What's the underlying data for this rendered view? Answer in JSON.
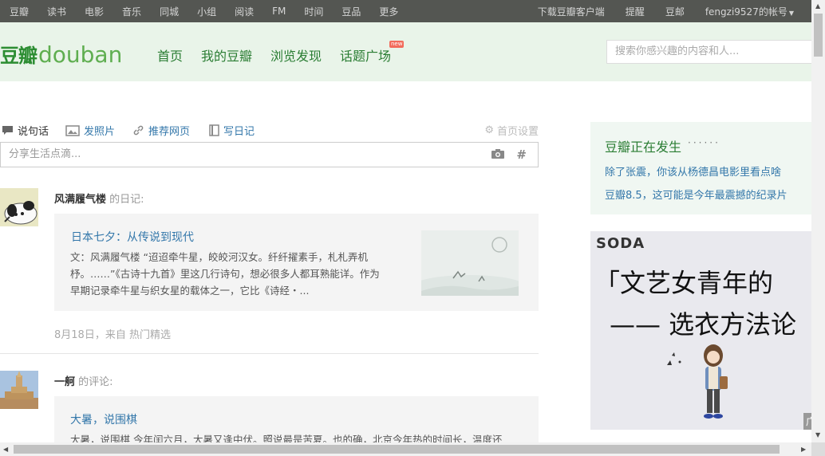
{
  "topnav": {
    "items": [
      "豆瓣",
      "读书",
      "电影",
      "音乐",
      "同城",
      "小组",
      "阅读",
      "FM",
      "时间",
      "豆品",
      "更多"
    ],
    "right": {
      "download": "下载豆瓣客户端",
      "remind": "提醒",
      "coin": "豆邮",
      "account": "fengzi9527的帐号"
    }
  },
  "logo": {
    "cn": "豆瓣",
    "en": "douban"
  },
  "mainnav": {
    "items": [
      "首页",
      "我的豆瓣",
      "浏览发现",
      "话题广场"
    ],
    "badge": "new"
  },
  "search": {
    "placeholder": "搜索你感兴趣的内容和人..."
  },
  "composer": {
    "tabs": [
      "说句话",
      "发照片",
      "推荐网页",
      "写日记"
    ],
    "settings": "首页设置",
    "placeholder": "分享生活点滴...",
    "hash": "#"
  },
  "feed": [
    {
      "user": "风满履气楼",
      "action": "的日记:",
      "title": "日本七夕：从传说到现代",
      "body_lines": [
        "文：风满履气楼 “迢迢牵牛星，皎皎河汉女。纤纤擢素手，札札弄机",
        "杼。……”《古诗十九首》里这几行诗句，想必很多人都耳熟能详。作为",
        "早期记录牵牛星与织女星的载体之一，它比《诗经・..."
      ],
      "meta": "8月18日，来自 热门精选"
    },
    {
      "user": "一舸",
      "action": "的评论:",
      "title": "大暑，说围棋",
      "body_lines": [
        "大暑，说围棋 今年闰六月，大暑又逢中伏。照说最是苦夏。也的确，北京今年热的时间长，温度还"
      ]
    }
  ],
  "happening": {
    "title": "豆瓣正在发生",
    "dots": "······",
    "links": [
      "除了张震，你该从杨德昌电影里看点啥",
      "豆瓣8.5，这可能是今年最震撼的纪录片"
    ]
  },
  "ad": {
    "brand": "SODA",
    "line1": "「文艺女青年的",
    "line2": "—— 选衣方法论",
    "corner": "广"
  },
  "colors": {
    "topbar": "#545652",
    "header": "#e9f4e9",
    "green": "#2a7d33",
    "link": "#3377aa"
  }
}
